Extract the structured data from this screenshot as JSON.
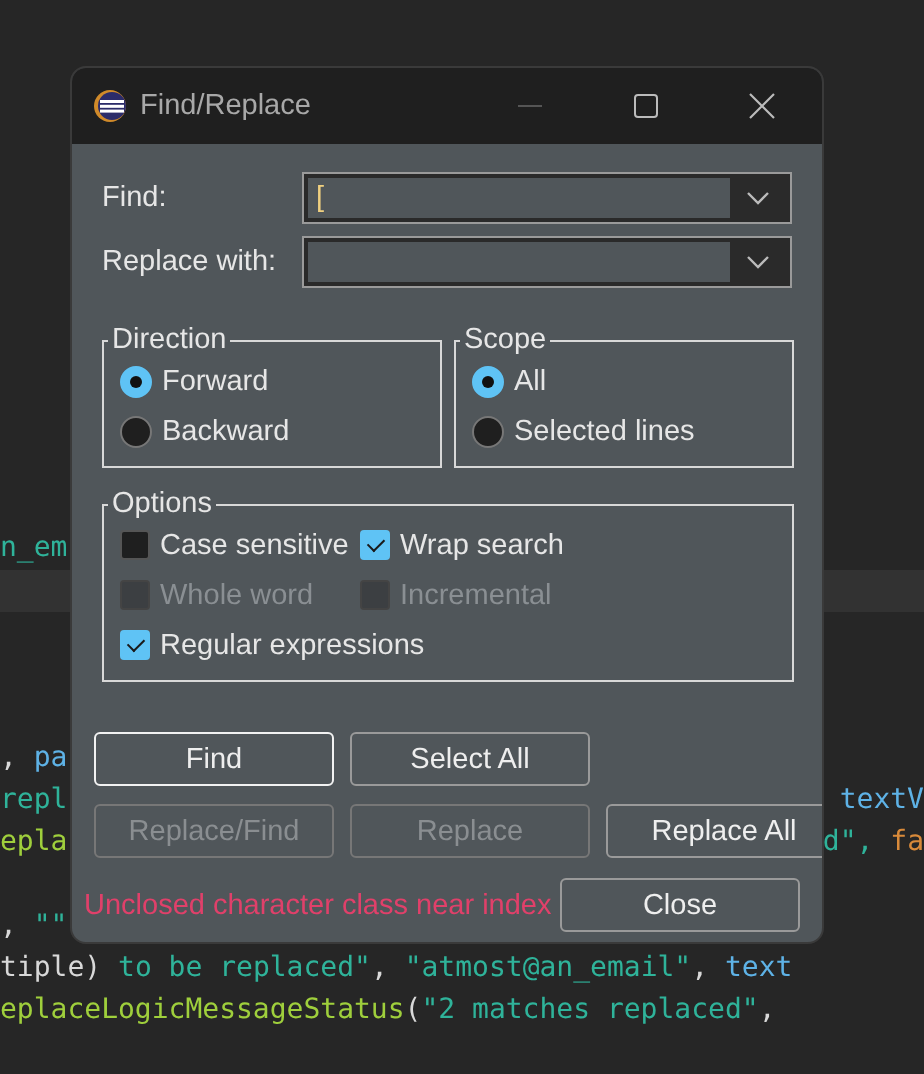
{
  "editor": {
    "lines": [
      {
        "current": false,
        "left": [
          {
            "text": "n_em",
            "kind": "string"
          }
        ]
      },
      {
        "current": true
      },
      {
        "current": false
      },
      {
        "current": false
      },
      {
        "current": false
      },
      {
        "current": false,
        "left": [
          {
            "text": ", ",
            "kind": "plain"
          },
          {
            "text": "pa",
            "kind": "field"
          }
        ]
      },
      {
        "current": false,
        "left": [
          {
            "text": "repl",
            "kind": "string"
          }
        ],
        "right": [
          {
            "text": "textV",
            "kind": "field"
          }
        ]
      },
      {
        "current": false,
        "left": [
          {
            "text": "epla",
            "kind": "method"
          }
        ],
        "right": [
          {
            "text": "d\", ",
            "kind": "string"
          },
          {
            "text": "fa",
            "kind": "keyword"
          }
        ]
      },
      {
        "current": false
      },
      {
        "current": false,
        "left": [
          {
            "text": ", ",
            "kind": "plain"
          },
          {
            "text": "\"\"",
            "kind": "string"
          }
        ]
      },
      {
        "current": false,
        "left": [
          {
            "text": "tiple) ",
            "kind": "plain"
          },
          {
            "text": "to be replaced\"",
            "kind": "string"
          },
          {
            "text": ", ",
            "kind": "plain"
          },
          {
            "text": "\"atmost@an_email\"",
            "kind": "string"
          },
          {
            "text": ", ",
            "kind": "plain"
          },
          {
            "text": "text",
            "kind": "field"
          }
        ]
      },
      {
        "current": false,
        "left": [
          {
            "text": "eplaceLogicMessageStatus",
            "kind": "method"
          },
          {
            "text": "(",
            "kind": "plain"
          },
          {
            "text": "\"2 matches replaced\"",
            "kind": "string"
          },
          {
            "text": ",",
            "kind": "plain"
          }
        ]
      }
    ]
  },
  "dialog": {
    "title": "Find/Replace",
    "find": {
      "label": "Find:",
      "value": "["
    },
    "replace": {
      "label": "Replace with:"
    },
    "direction": {
      "title": "Direction",
      "options": [
        {
          "label": "Forward",
          "selected": true
        },
        {
          "label": "Backward",
          "selected": false
        }
      ]
    },
    "scope": {
      "title": "Scope",
      "options": [
        {
          "label": "All",
          "selected": true
        },
        {
          "label": "Selected lines",
          "selected": false
        }
      ]
    },
    "options": {
      "title": "Options",
      "items": [
        {
          "label": "Case sensitive",
          "checked": false,
          "disabled": false
        },
        {
          "label": "Wrap search",
          "checked": true,
          "disabled": false
        },
        {
          "label": "Whole word",
          "checked": false,
          "disabled": true
        },
        {
          "label": "Incremental",
          "checked": false,
          "disabled": true
        },
        {
          "label": "Regular expressions",
          "checked": true,
          "disabled": false
        }
      ]
    },
    "buttons": [
      {
        "label": "Find",
        "disabled": false,
        "default": true
      },
      {
        "label": "Select All",
        "disabled": false,
        "default": false
      },
      {
        "label": "Replace/Find",
        "disabled": true,
        "default": false
      },
      {
        "label": "Replace",
        "disabled": true,
        "default": false
      },
      {
        "label": "Replace All",
        "disabled": false,
        "default": false
      }
    ],
    "status": {
      "text": "Unclosed character class near index",
      "color": "#e0406a"
    },
    "close": {
      "label": "Close"
    }
  }
}
